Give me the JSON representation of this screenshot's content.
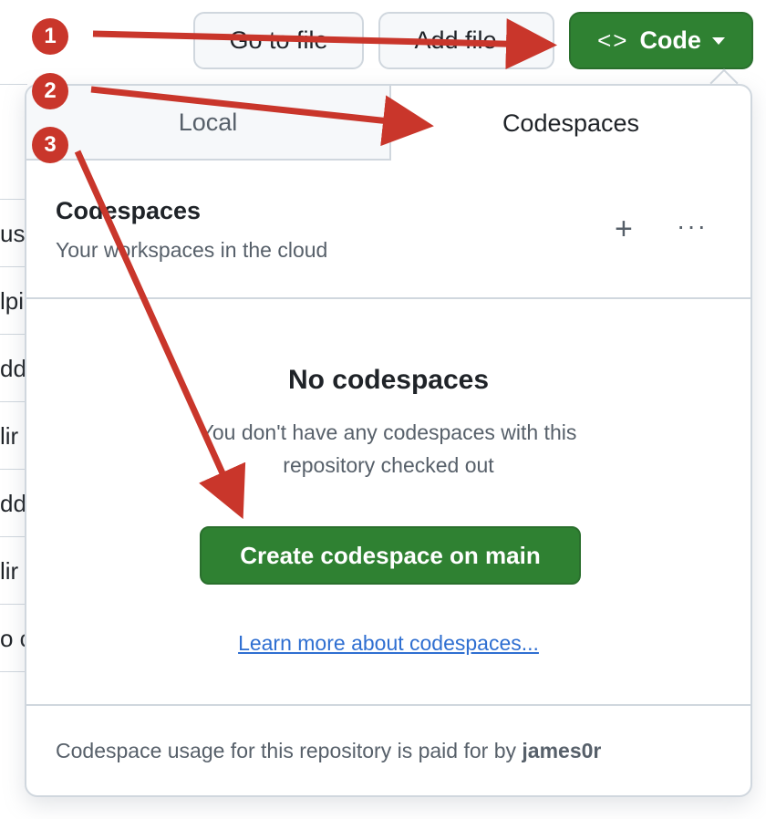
{
  "toolbar": {
    "go_to_file": "Go to file",
    "add_file": "Add file",
    "code": "Code"
  },
  "background_rows": [
    "use",
    "lpi",
    "dd",
    "lir",
    "dd",
    "lir",
    "o c"
  ],
  "dropdown": {
    "tabs": [
      {
        "label": "Local",
        "active": false
      },
      {
        "label": "Codespaces",
        "active": true
      }
    ],
    "section_title": "Codespaces",
    "section_subtitle": "Your workspaces in the cloud",
    "empty_title": "No codespaces",
    "empty_description": "You don't have any codespaces with this repository checked out",
    "create_button": "Create codespace on main",
    "learn_more": "Learn more about codespaces...",
    "footer_text": "Codespace usage for this repository is paid for by",
    "footer_user": "james0r"
  },
  "annotations": [
    {
      "number": "1"
    },
    {
      "number": "2"
    },
    {
      "number": "3"
    }
  ],
  "colors": {
    "accent_green": "#2f8132",
    "annotation_red": "#c9362b",
    "link_blue": "#2f6fd1"
  }
}
